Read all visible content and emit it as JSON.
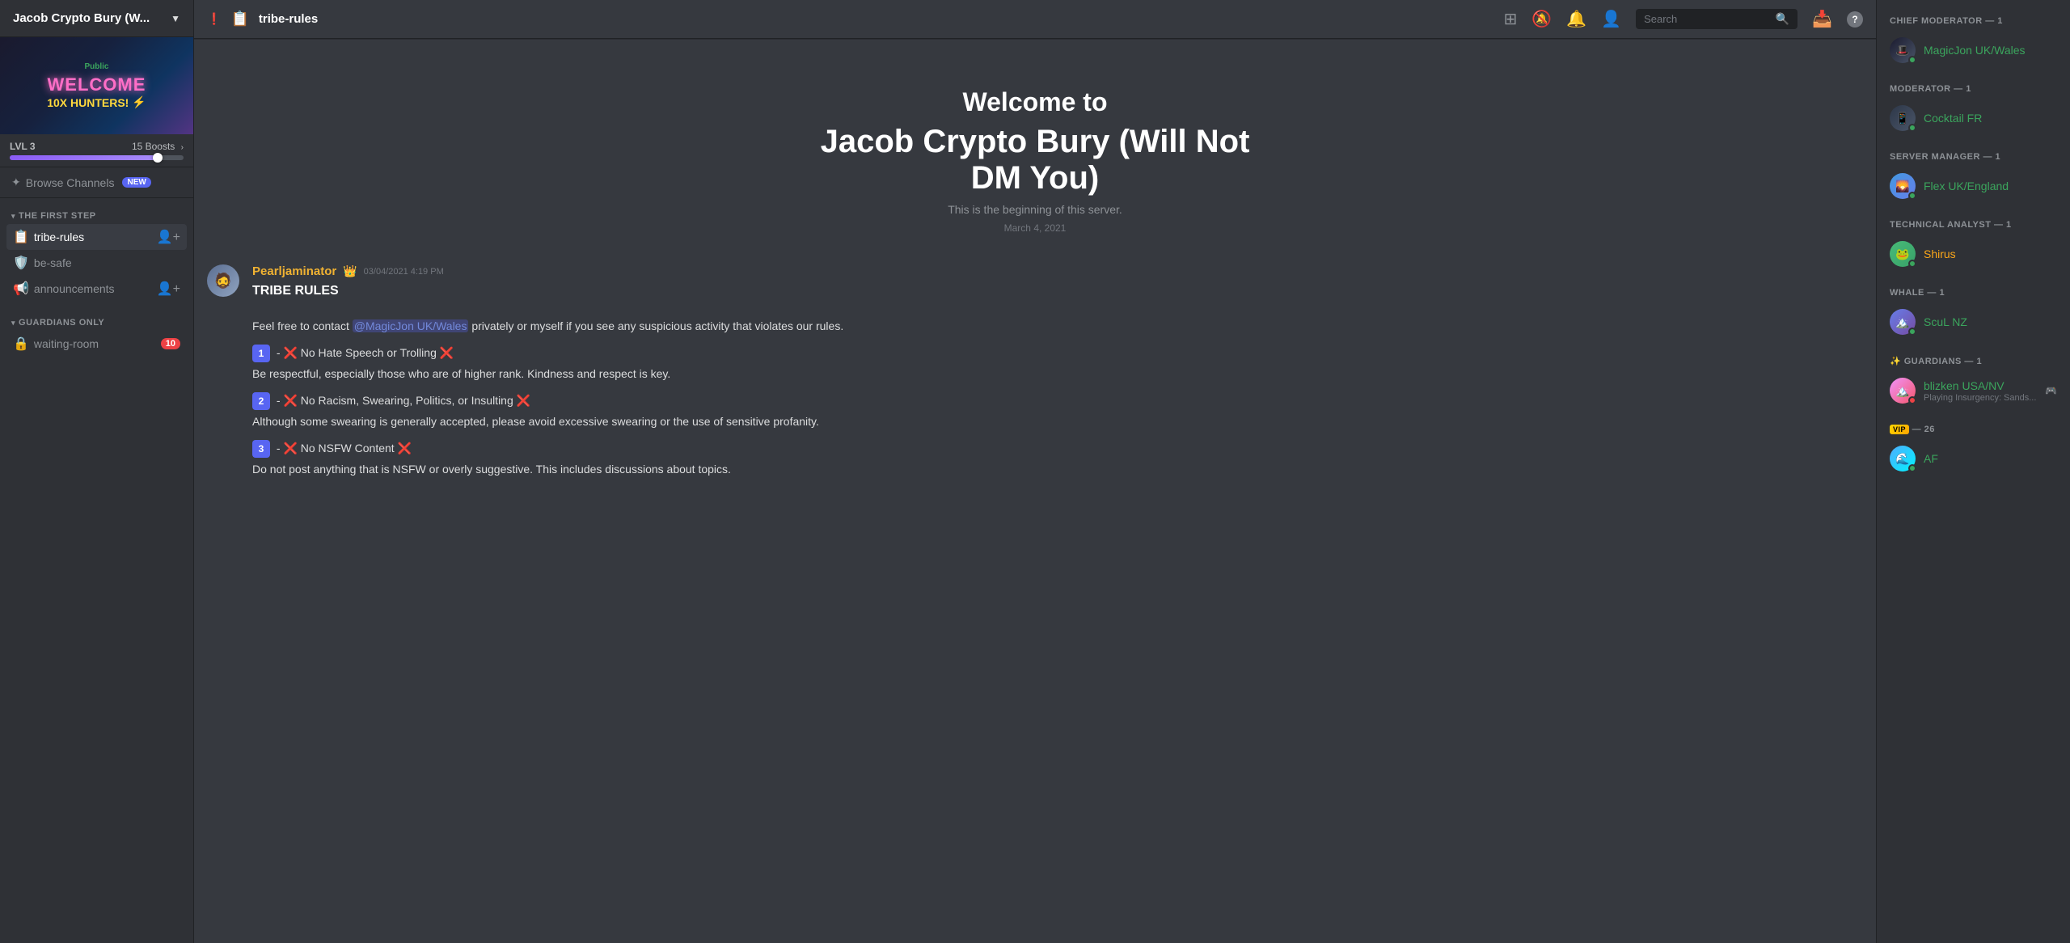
{
  "server": {
    "name": "Jacob Crypto Bury (W...",
    "public_label": "Public",
    "lvl": "LVL 3",
    "boosts": "15 Boosts",
    "boost_percent": 85
  },
  "banner": {
    "welcome": "WELCOME",
    "subtitle": "10X HUNTERS!",
    "lightning": "⚡"
  },
  "browse_channels": {
    "label": "Browse Channels",
    "badge": "NEW"
  },
  "sections": {
    "first_step": {
      "title": "THE FIRST STEP",
      "channels": [
        {
          "icon": "📋",
          "name": "tribe-rules",
          "prefix": "#",
          "active": true,
          "has_add": true
        },
        {
          "icon": "🛡️",
          "name": "be-safe",
          "prefix": "#"
        },
        {
          "icon": "📢",
          "name": "announcements",
          "prefix": "#",
          "has_add": true
        }
      ]
    },
    "guardians_only": {
      "title": "GUARDIANS ONLY",
      "channels": [
        {
          "icon": "🔒",
          "name": "waiting-room",
          "prefix": "#",
          "badge": 10
        }
      ]
    }
  },
  "topbar": {
    "channel_name": "tribe-rules",
    "search_placeholder": "Search",
    "icons": {
      "hashtag": "#",
      "bell": "🔔",
      "pin": "📌",
      "person": "👤",
      "inbox": "📥",
      "help": "?"
    }
  },
  "welcome": {
    "line1": "Welcome to",
    "line2": "Jacob Crypto Bury (Will Not",
    "line3": "DM You)",
    "desc": "This is the beginning of this server.",
    "date": "March 4, 2021"
  },
  "message": {
    "author": "Pearljaminator",
    "author_crown": "👑",
    "timestamp": "03/04/2021 4:19 PM",
    "title": "TRIBE RULES",
    "intro": "Feel free to contact",
    "mention": "@MagicJon UK/Wales",
    "intro2": "privately or myself if you see any suspicious activity that violates our rules.",
    "rules": [
      {
        "number": "1",
        "icon_left": "❌",
        "title": "No Hate Speech or Trolling",
        "icon_right": "❌",
        "desc": "Be respectful, especially those who are of higher rank. Kindness and respect is key."
      },
      {
        "number": "2",
        "icon_left": "❌",
        "title": "No Racism, Swearing, Politics, or Insulting",
        "icon_right": "❌",
        "desc": "Although some swearing is generally accepted, please avoid excessive swearing or the use of sensitive profanity."
      },
      {
        "number": "3",
        "icon_left": "❌",
        "title": "No NSFW Content",
        "icon_right": "❌",
        "desc": "Do not post anything that is NSFW or overly suggestive. This includes discussions about topics."
      }
    ]
  },
  "members": {
    "chief_moderator": {
      "title": "CHIEF MODERATOR — 1",
      "items": [
        {
          "name": "MagicJon UK/Wales",
          "avatar_class": "avatar-magicjon",
          "emoji": "🎩",
          "status_dot": "online",
          "color": "moderator"
        }
      ]
    },
    "moderator": {
      "title": "MODERATOR — 1",
      "items": [
        {
          "name": "Cocktail FR",
          "avatar_class": "avatar-cocktail",
          "emoji": "📱",
          "status_dot": "online",
          "color": "moderator"
        }
      ]
    },
    "server_manager": {
      "title": "SERVER MANAGER — 1",
      "items": [
        {
          "name": "Flex UK/England",
          "avatar_class": "avatar-flex",
          "emoji": "🌄",
          "status_dot": "online",
          "color": "server-manager"
        }
      ]
    },
    "technical_analyst": {
      "title": "TECHNICAL ANALYST — 1",
      "items": [
        {
          "name": "Shirus",
          "avatar_class": "avatar-shirus",
          "emoji": "🐸",
          "status_dot": "online",
          "color": "technical-analyst"
        }
      ]
    },
    "whale": {
      "title": "WHALE — 1",
      "items": [
        {
          "name": "ScuL NZ",
          "avatar_class": "avatar-scul",
          "emoji": "🏔️",
          "status_dot": "online",
          "color": "whale"
        }
      ]
    },
    "guardians": {
      "title": "✨ GUARDIANS — 1",
      "items": [
        {
          "name": "blizken USA/NV",
          "avatar_class": "avatar-blizken",
          "emoji": "🏔️",
          "status_dot": "dnd",
          "color": "guardian",
          "status_text": "Playing Insurgency: Sands..."
        }
      ]
    },
    "vip": {
      "title": "VIP — 26",
      "items": [
        {
          "name": "AF",
          "avatar_class": "avatar-af",
          "emoji": "🌊",
          "status_dot": "online",
          "color": "moderator"
        }
      ]
    }
  }
}
